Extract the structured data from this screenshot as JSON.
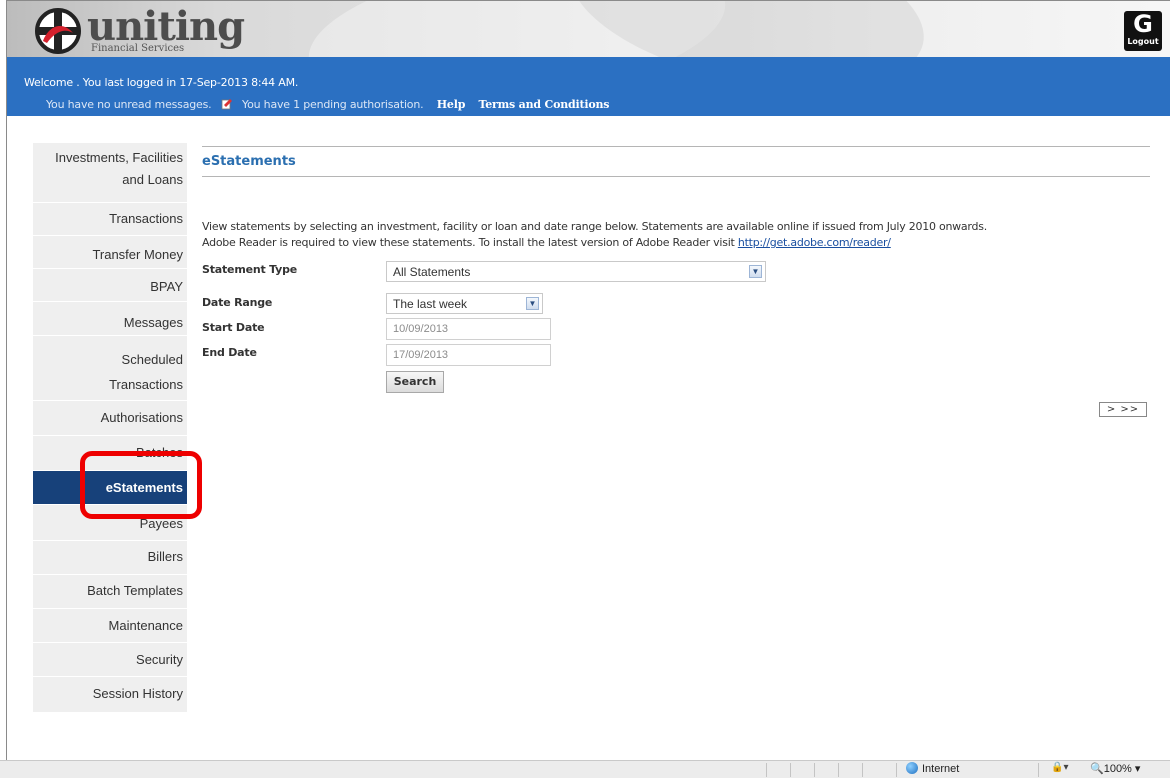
{
  "brand": {
    "name": "uniting",
    "subtitle": "Financial Services",
    "logout_label": "Logout"
  },
  "session": {
    "welcome": "Welcome . You last logged in 17-Sep-2013 8:44 AM.",
    "messages": "You have no unread messages.",
    "pending": "You have 1 pending authorisation.",
    "help_label": "Help",
    "terms_label": "Terms and Conditions"
  },
  "sidebar": {
    "items": [
      {
        "label_line1": "Investments, Facilities",
        "label_line2": "and Loans"
      },
      {
        "label": "Transactions"
      },
      {
        "label": "Transfer Money"
      },
      {
        "label": "BPAY"
      },
      {
        "label": "Messages"
      },
      {
        "label_line1": "Scheduled",
        "label_line2": "Transactions"
      },
      {
        "label": "Authorisations"
      },
      {
        "label": "Batches"
      },
      {
        "label": "eStatements",
        "active": true
      },
      {
        "label": "Payees"
      },
      {
        "label": "Billers"
      },
      {
        "label": "Batch Templates"
      },
      {
        "label": "Maintenance"
      },
      {
        "label": "Security"
      },
      {
        "label": "Session History"
      }
    ]
  },
  "main": {
    "title": "eStatements",
    "desc_line1": "View statements by selecting an investment, facility or loan and date range below. Statements are available online if issued from July 2010 onwards.",
    "desc_line2": "Adobe Reader is required to view these statements. To install the latest version of Adobe Reader visit",
    "desc_link": "http://get.adobe.com/reader/",
    "statement_type_label": "Statement Type",
    "statement_type_value": "All Statements",
    "date_range_label": "Date Range",
    "date_range_value": "The last week",
    "start_date_label": "Start Date",
    "start_date_value": "10/09/2013",
    "end_date_label": "End Date",
    "end_date_value": "17/09/2013",
    "search_label": "Search",
    "pager_label": "> >>"
  },
  "statusbar": {
    "zone": "Internet",
    "zoom": "100%"
  },
  "colors": {
    "blue_bar": "#2b70c2",
    "active_nav": "#17417a",
    "title": "#2b6fb0",
    "highlight": "#ee0000"
  }
}
